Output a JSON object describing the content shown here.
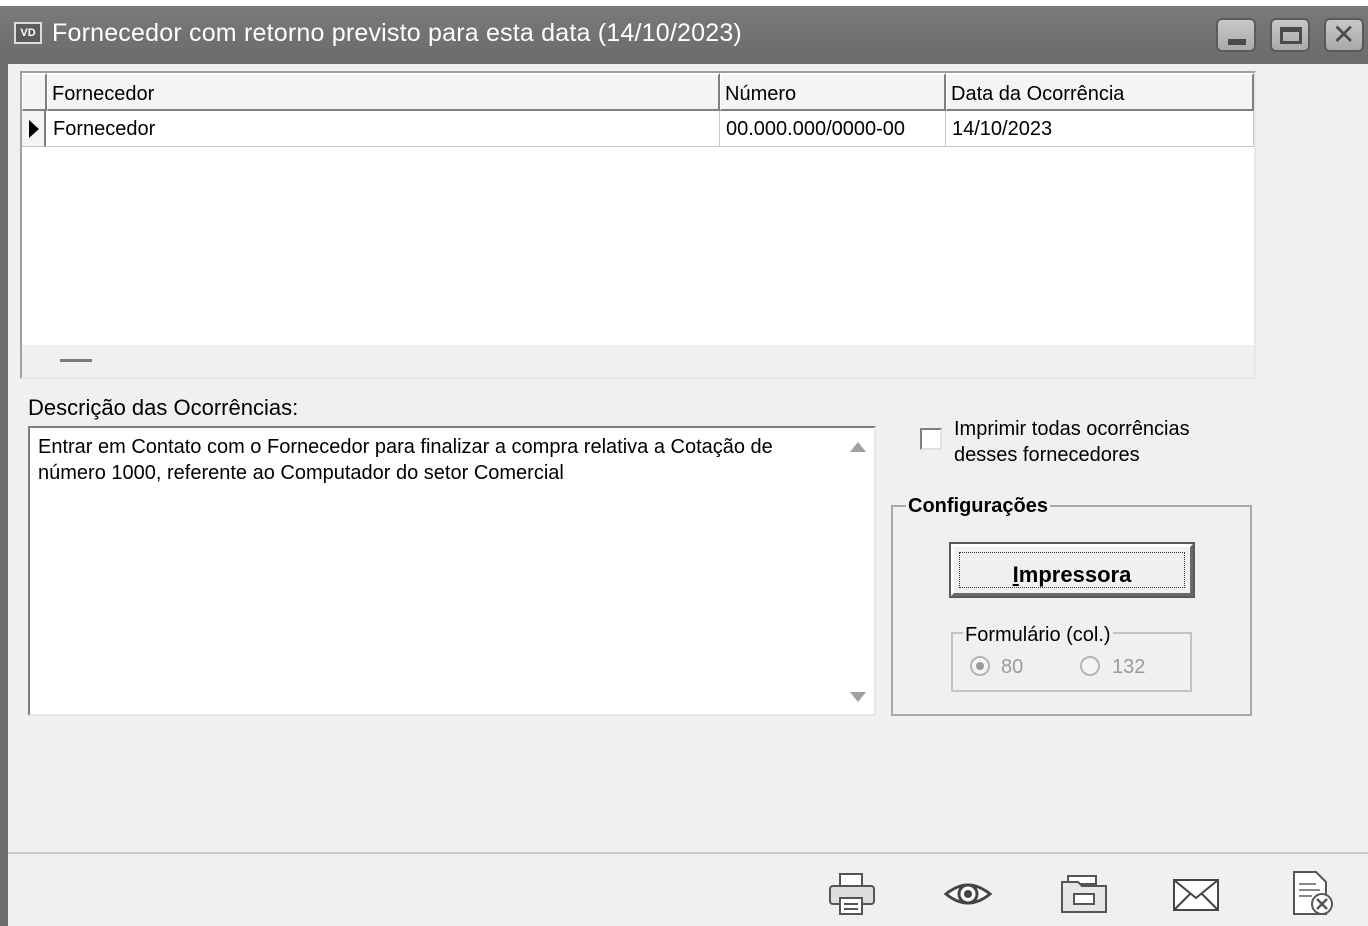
{
  "window": {
    "app_icon_text": "VD",
    "title": "Fornecedor com retorno previsto para esta data  (14/10/2023)",
    "buttons": [
      "minimize",
      "maximize",
      "close"
    ]
  },
  "grid": {
    "columns": [
      "Fornecedor",
      "Número",
      "Data da Ocorrência"
    ],
    "rows": [
      {
        "fornecedor": "Fornecedor",
        "numero": "00.000.000/0000-00",
        "data": "14/10/2023"
      }
    ]
  },
  "description": {
    "label": "Descrição das Ocorrências:",
    "text": "Entrar em Contato com o Fornecedor para finalizar a compra relativa a Cotação de número 1000, referente ao Computador do setor Comercial"
  },
  "print_all": {
    "label": "Imprimir todas ocorrências desses fornecedores",
    "checked": false
  },
  "config": {
    "title": "Configurações",
    "printer_button": "Impressora",
    "printer_button_accel": "I",
    "printer_button_rest": "mpressora",
    "form_group_title": "Formulário (col.)",
    "options": [
      "80",
      "132"
    ],
    "selected": "80"
  },
  "toolbar": {
    "icons": [
      "printer-icon",
      "preview-eye-icon",
      "export-folder-icon",
      "email-icon",
      "close-document-icon"
    ]
  }
}
